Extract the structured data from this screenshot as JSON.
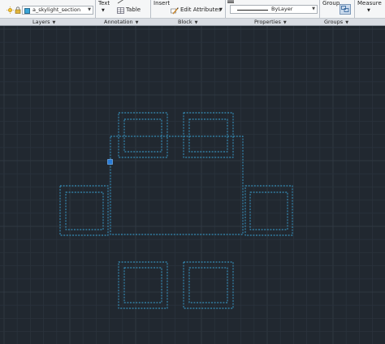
{
  "ribbon": {
    "layers_panel": {
      "title": "Layers",
      "current_layer": "a_skylight_section",
      "layer_color": "#3aa6d8"
    },
    "annotation_panel": {
      "title": "Annotation",
      "text_label": "Text",
      "table_label": "Table"
    },
    "block_panel": {
      "title": "Block",
      "insert_label": "Insert",
      "edit_attributes_label": "Edit Attributes"
    },
    "properties_panel": {
      "title": "Properties",
      "linetype_value": "ByLayer"
    },
    "groups_panel": {
      "title": "Groups",
      "group_label": "Group"
    },
    "utilities_panel": {
      "measure_label": "Measure"
    }
  },
  "canvas": {
    "background_color": "#212830",
    "grid_minor_color": "#2a323c",
    "grid_major_color": "#333c47",
    "selection_color": "#3aa6d8",
    "grip_color": "#2a7bd6"
  }
}
